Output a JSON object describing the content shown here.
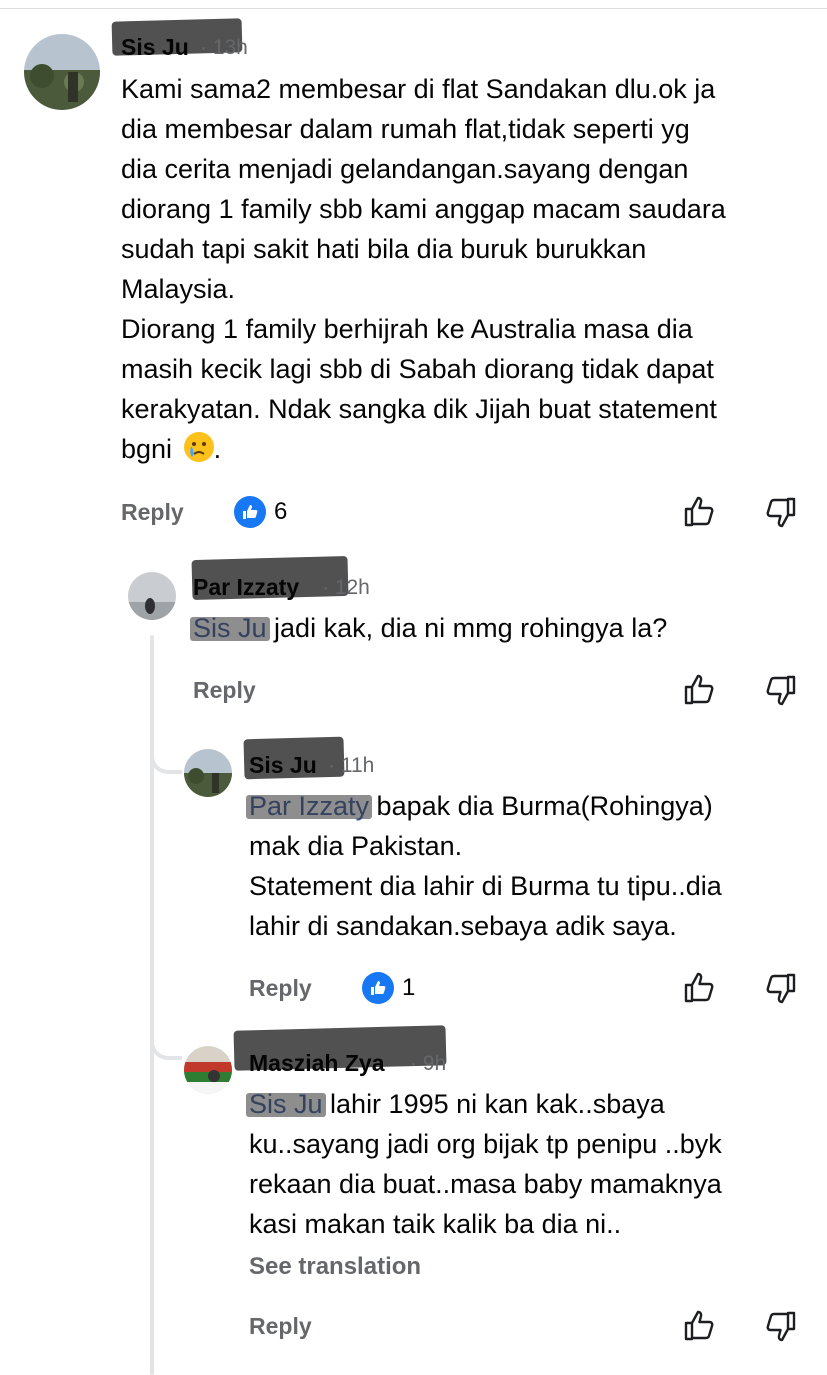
{
  "comments": [
    {
      "author": "Sis Ju",
      "time": "13h",
      "lines": [
        "Kami sama2 membesar di flat Sandakan dlu.ok ja",
        "dia membesar dalam rumah flat,tidak seperti yg",
        "dia cerita menjadi gelandangan.sayang dengan",
        "diorang 1 family sbb kami anggap macam saudara",
        "sudah tapi sakit hati bila dia buruk burukkan",
        "Malaysia.",
        "Diorang 1 family berhijrah ke Australia masa dia",
        "masih kecik lagi sbb di Sabah diorang tidak dapat",
        "kerakyatan. Ndak sangka dik Jijah buat statement"
      ],
      "last_line_text": "bgni",
      "last_line_suffix": ".",
      "emoji": "crying-face-emoji",
      "reply_label": "Reply",
      "like_count": "6"
    },
    {
      "author": "Par Izzaty",
      "time": "12h",
      "mention": "Sis Ju",
      "lines": [
        " jadi kak, dia ni mmg rohingya la?"
      ],
      "reply_label": "Reply"
    },
    {
      "author": "Sis Ju",
      "time": "11h",
      "mention": "Par Izzaty",
      "first_line_rest": " bapak dia Burma(Rohingya)",
      "lines": [
        "mak dia Pakistan.",
        "Statement dia lahir di Burma tu tipu..dia",
        "lahir di sandakan.sebaya adik saya."
      ],
      "reply_label": "Reply",
      "like_count": "1"
    },
    {
      "author": "Masziah Zya",
      "time": "9h",
      "mention": "Sis Ju",
      "first_line_rest": " lahir 1995 ni kan kak..sbaya",
      "lines": [
        "ku..sayang jadi org bijak tp penipu ..byk",
        "rekaan dia buat..masa baby mamaknya",
        "kasi makan taik kalik ba dia ni.."
      ],
      "see_translation": "See translation",
      "reply_label": "Reply"
    }
  ],
  "colors": {
    "secondary_text": "#65676b",
    "like_blue": "#1877f2",
    "mention": "#385898",
    "thread_line": "#e3e4e6"
  },
  "icons": [
    "thumbs-up-icon",
    "thumbs-down-icon",
    "like-reaction-icon"
  ]
}
